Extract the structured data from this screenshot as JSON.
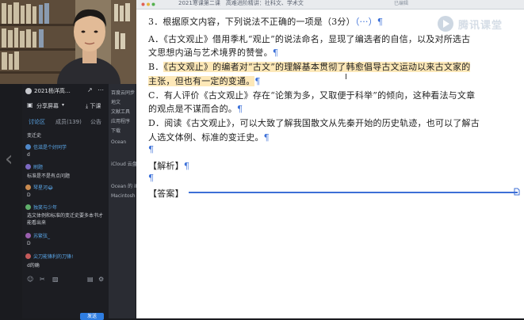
{
  "window": {
    "title": "2021寒课第二课　高难进阶精讲：社科文、学术文",
    "edit_status": "已编辑"
  },
  "brand": {
    "name": "腾讯课堂"
  },
  "chat_panel": {
    "room_title": "2021杨洋高…",
    "share_label": "分享屏幕",
    "download_label": "下课",
    "tabs": [
      "讨论区",
      "成员(139)",
      "公告"
    ],
    "notice": "变迁史",
    "messages": [
      {
        "name": "信滋是个好同学",
        "text": "d"
      },
      {
        "name": "刷题",
        "text": "标准是不是有点问题"
      },
      {
        "name": "琴星河😂",
        "text": "D"
      },
      {
        "name": "独笑与少年",
        "text": "选文体例和标准的变迁史要多本书才能看出来"
      },
      {
        "name": "苏繁弦_",
        "text": "D"
      },
      {
        "name": "尖刀能锋利的刀锋!",
        "text": "d的确"
      }
    ],
    "send_label": "发送"
  },
  "mid_list": [
    "百度云同步",
    "地文",
    "文献工具",
    "应用程序",
    "下载",
    "Ocean",
    "iCloud 云盘",
    "Ocean 的 iMac",
    "Macintosh"
  ],
  "document": {
    "q_num": "3．",
    "q_stem": "根据原文内容，下列说法不正确的一项是（3分）",
    "q_mark": "（···）",
    "options": [
      {
        "label": "A．",
        "text1": "《古文观止》借用季札“观止”的说法命名，显现了编选者的自信，以及对所选古",
        "text2": "文思想内涵与艺术境界的赞誉。"
      },
      {
        "label": "B．",
        "text1": "《古文观止》的编者对“古文”的理解基本贯彻了韩愈倡导古文运动以来古文家的",
        "text2": "主张，但也有一定的变通。"
      },
      {
        "label": "C．",
        "text1": "有人评价《古文观止》存在“论策为多，又取便于科举”的倾向，这种看法与文章",
        "text2": "的观点是不谋而合的。"
      },
      {
        "label": "D．",
        "text1": "阅读《古文观止》，可以大致了解我国散文从先秦开始的历史轨迹，也可以了解古",
        "text2": "人选文体例、标准的变迁史。"
      }
    ],
    "analysis": "【解析】",
    "answer": "【答案】",
    "pilcrow": "¶"
  }
}
